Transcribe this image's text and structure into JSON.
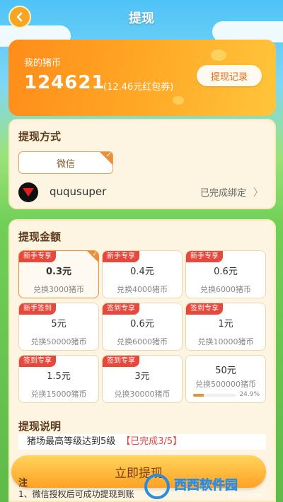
{
  "header": {
    "title": "提现",
    "back_icon": "back-arrow-icon"
  },
  "coins": {
    "label": "我的猪币",
    "amount": "124621",
    "equivalent": "(12.46元红包券)",
    "record_button": "提现记录"
  },
  "method": {
    "title": "提现方式",
    "option": "微信",
    "username": "ququsuper",
    "status": "已完成绑定"
  },
  "amount": {
    "title": "提现金额",
    "options": [
      {
        "tag": "新手专享",
        "price": "0.3元",
        "exchange": "兑换3000猪币",
        "selected": true
      },
      {
        "tag": "新手专享",
        "price": "0.4元",
        "exchange": "兑换4000猪币"
      },
      {
        "tag": "新手专享",
        "price": "0.6元",
        "exchange": "兑换6000猪币"
      },
      {
        "tag": "新手签到",
        "price": "5元",
        "exchange": "兑换50000猪币"
      },
      {
        "tag": "签到专享",
        "price": "0.6元",
        "exchange": "兑换6000猪币"
      },
      {
        "tag": "签到专享",
        "price": "1元",
        "exchange": "兑换10000猪币"
      },
      {
        "tag": "签到专享",
        "price": "1.5元",
        "exchange": "兑换15000猪币"
      },
      {
        "tag": "签到专享",
        "price": "3元",
        "exchange": "兑换30000猪币"
      },
      {
        "tag": "",
        "price": "50元",
        "exchange": "兑换500000猪币",
        "progress": 0.249,
        "progress_text": "24.9%"
      }
    ]
  },
  "description": {
    "title": "提现说明",
    "task": "猪场最高等级达到5级",
    "task_status": "【已完成3/5】",
    "note_head": "注",
    "note": "1、微信授权后可成功提现到账"
  },
  "withdraw_button": "立即提现",
  "watermark": {
    "text": "西西软件园",
    "url": "CR173.COM"
  },
  "colors": {
    "accent": "#e8903a",
    "tag_red": "#e8473c",
    "card_orange": "#ffa524"
  }
}
